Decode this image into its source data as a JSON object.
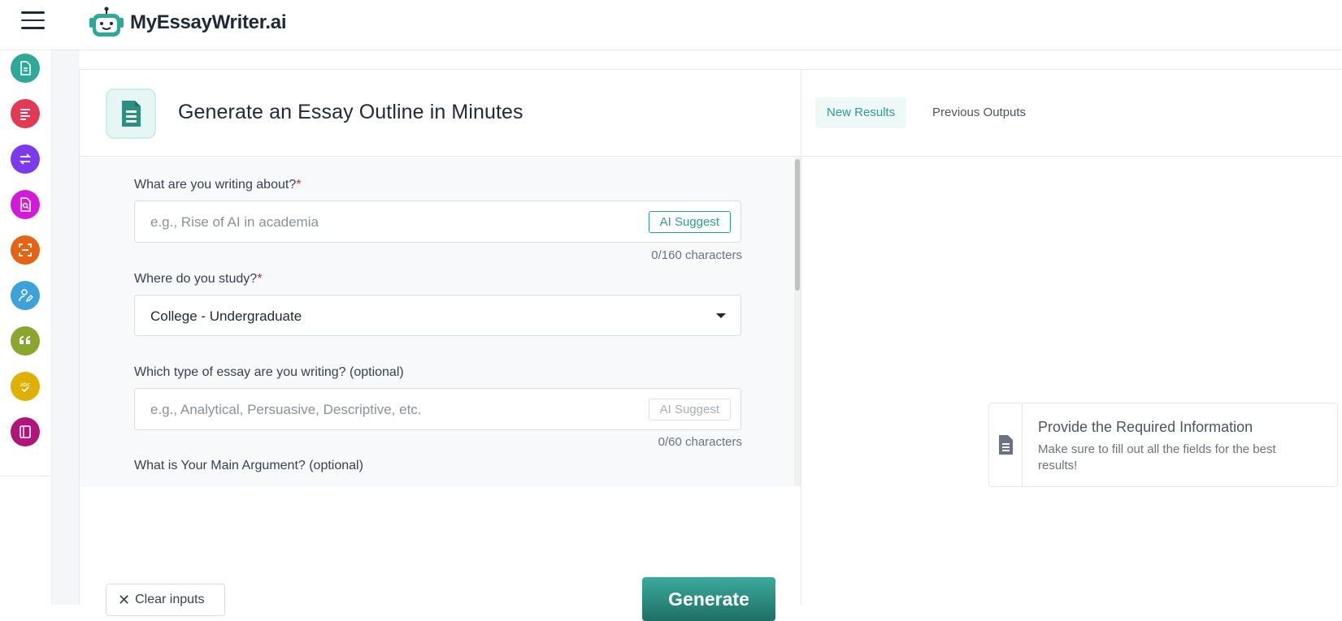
{
  "app": {
    "brand": "MyEssayWriter.ai",
    "accent": "#2b9e8f"
  },
  "sidebar": {
    "items": [
      {
        "icon": "document-icon",
        "color": "#2fa89a"
      },
      {
        "icon": "text-lines-icon",
        "color": "#e23a55"
      },
      {
        "icon": "paraphrase-icon",
        "color": "#7c3aed"
      },
      {
        "icon": "document-search-icon",
        "color": "#d21bd8"
      },
      {
        "icon": "scan-text-icon",
        "color": "#e36414"
      },
      {
        "icon": "user-edit-icon",
        "color": "#3ba3d9"
      },
      {
        "icon": "quote-icon",
        "color": "#8aa62c"
      },
      {
        "icon": "spell-check-icon",
        "color": "#e0b000"
      },
      {
        "icon": "notebook-icon",
        "color": "#b0157a"
      }
    ]
  },
  "main": {
    "title": "Generate an Essay Outline in Minutes",
    "fields": {
      "topic": {
        "label": "What are you writing about?",
        "required": "*",
        "placeholder": "e.g., Rise of AI in academia",
        "suggest": "AI Suggest",
        "counter": "0/160 characters"
      },
      "study": {
        "label": "Where do you study?",
        "required": "*",
        "value": "College - Undergraduate"
      },
      "essay_type": {
        "label": "Which type of essay are you writing? (optional)",
        "placeholder": "e.g., Analytical, Persuasive, Descriptive, etc.",
        "suggest": "AI Suggest",
        "counter": "0/60 characters"
      },
      "argument": {
        "label": "What is Your Main Argument? (optional)"
      }
    },
    "clear_label": "Clear inputs",
    "generate_label": "Generate"
  },
  "results": {
    "tabs": [
      "New Results",
      "Previous Outputs"
    ],
    "empty_title": "Provide the Required Information",
    "empty_desc": "Make sure to fill out all the fields for the best results!"
  }
}
